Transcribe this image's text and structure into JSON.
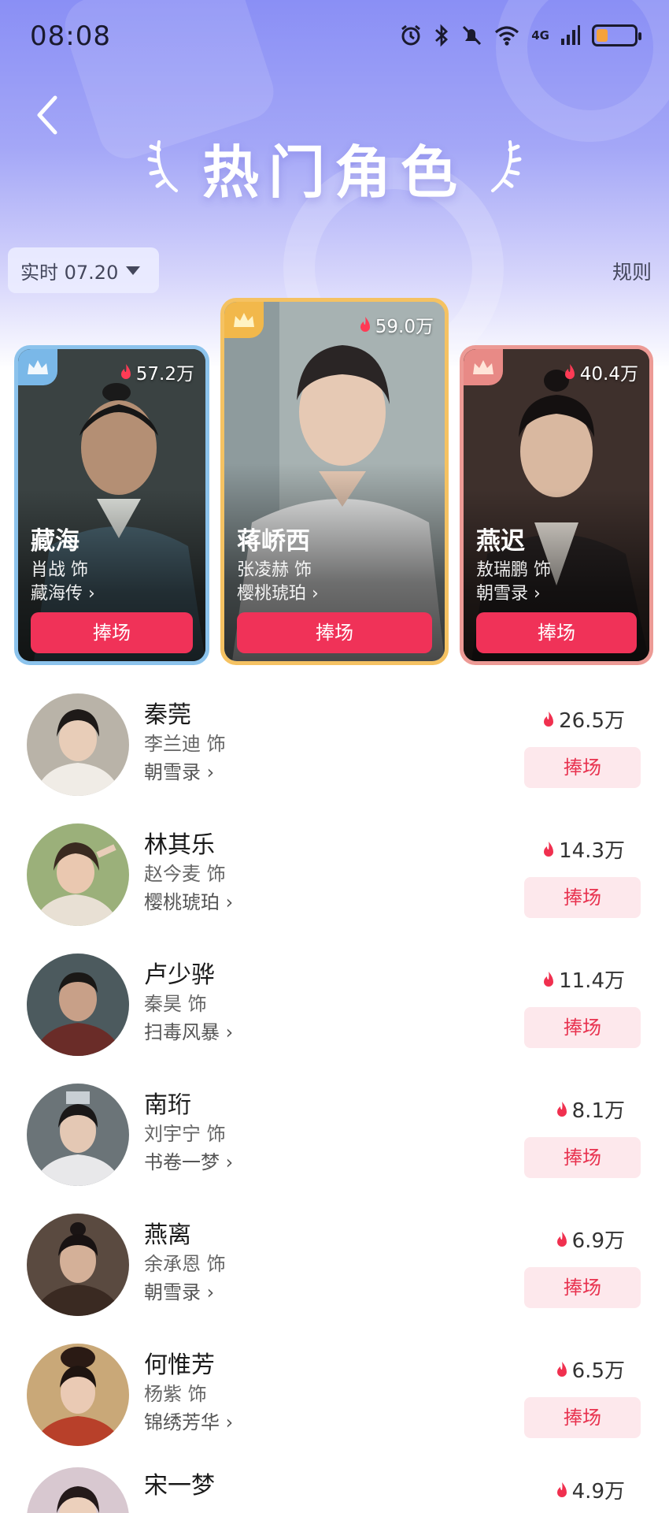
{
  "status": {
    "time": "08:08",
    "network": "4G"
  },
  "header": {
    "title": "热门角色",
    "date_filter": "实时 07.20",
    "rules": "规则"
  },
  "top_cards": [
    {
      "rank": 2,
      "name": "藏海",
      "actor": "肖战 饰",
      "drama": "藏海传",
      "heat": "57.2万",
      "button": "捧场",
      "accent": "#7ab8e8"
    },
    {
      "rank": 1,
      "name": "蒋峤西",
      "actor": "张凌赫 饰",
      "drama": "樱桃琥珀",
      "heat": "59.0万",
      "button": "捧场",
      "accent": "#f2b84b"
    },
    {
      "rank": 3,
      "name": "燕迟",
      "actor": "敖瑞鹏 饰",
      "drama": "朝雪录",
      "heat": "40.4万",
      "button": "捧场",
      "accent": "#e88a86"
    }
  ],
  "list": [
    {
      "name": "秦莞",
      "actor": "李兰迪 饰",
      "drama": "朝雪录",
      "heat": "26.5万",
      "button": "捧场"
    },
    {
      "name": "林其乐",
      "actor": "赵今麦 饰",
      "drama": "樱桃琥珀",
      "heat": "14.3万",
      "button": "捧场"
    },
    {
      "name": "卢少骅",
      "actor": "秦昊 饰",
      "drama": "扫毒风暴",
      "heat": "11.4万",
      "button": "捧场"
    },
    {
      "name": "南珩",
      "actor": "刘宇宁 饰",
      "drama": "书卷一梦",
      "heat": "8.1万",
      "button": "捧场"
    },
    {
      "name": "燕离",
      "actor": "余承恩 饰",
      "drama": "朝雪录",
      "heat": "6.9万",
      "button": "捧场"
    },
    {
      "name": "何惟芳",
      "actor": "杨紫 饰",
      "drama": "锦绣芳华",
      "heat": "6.5万",
      "button": "捧场"
    },
    {
      "name": "宋一梦",
      "actor": "",
      "drama": "",
      "heat": "4.9万",
      "button": ""
    }
  ],
  "colors": {
    "accent": "#f03258",
    "button_light": "#fde8ec",
    "hero": "#8a8ff5"
  }
}
